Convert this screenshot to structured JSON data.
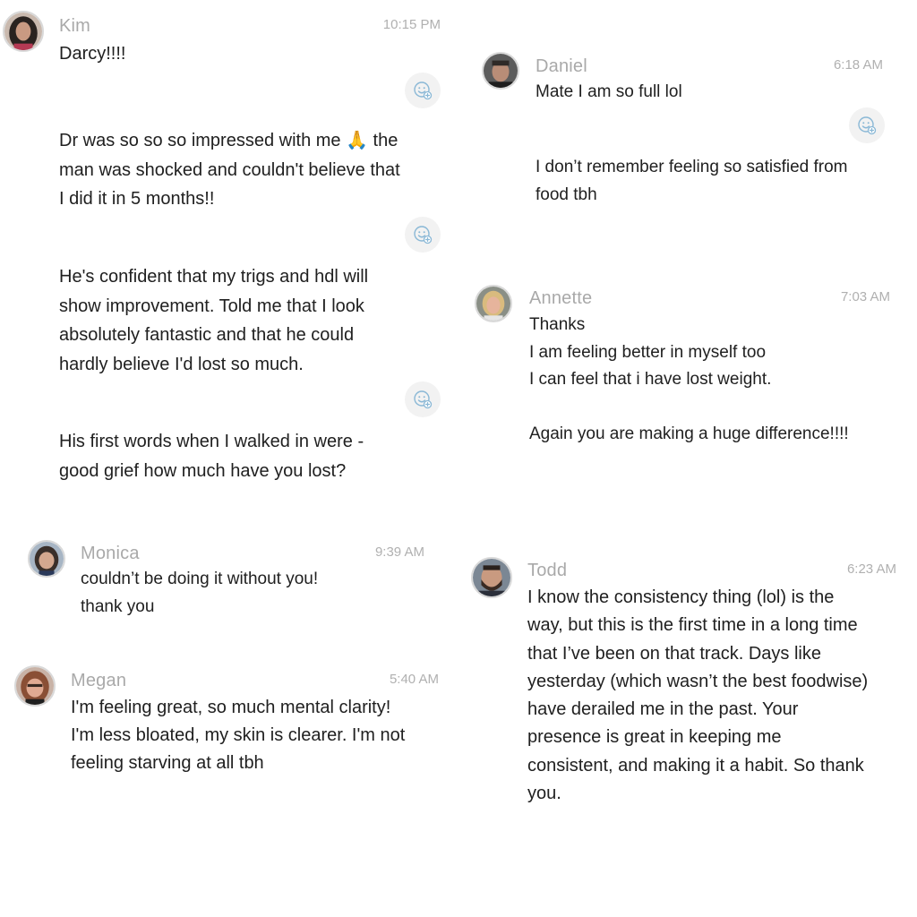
{
  "colors": {
    "name": "#a9a9a9",
    "time": "#b0b0b0",
    "text": "#202020",
    "react_icon": "#8ab8d6",
    "react_bg": "#f2f2f2"
  },
  "messages": {
    "kim": {
      "name": "Kim",
      "time": "10:15 PM",
      "texts": [
        "Darcy!!!!",
        "Dr was so so so impressed with me 🙏 the\nman was shocked and couldn't believe that\nI did it in 5 months!!",
        "He's confident that my trigs and hdl will\nshow improvement. Told me that I look\nabsolutely fantastic and that he could\nhardly believe I'd lost so much.",
        "His first words when I walked in were -\ngood grief how much have you lost?"
      ]
    },
    "daniel": {
      "name": "Daniel",
      "time": "6:18 AM",
      "texts": [
        "Mate I am so full lol",
        "I don’t remember feeling so satisfied from\nfood tbh"
      ]
    },
    "annette": {
      "name": "Annette",
      "time": "7:03 AM",
      "text": "Thanks\nI am feeling better in myself too\nI can feel that i have lost weight.\n\nAgain you are making a huge difference!!!!"
    },
    "monica": {
      "name": "Monica",
      "time": "9:39 AM",
      "text": "couldn’t be doing it without you!\nthank you"
    },
    "megan": {
      "name": "Megan",
      "time": "5:40 AM",
      "text": "I'm feeling great, so much mental clarity!\nI'm less bloated, my skin is clearer. I'm not\nfeeling starving at all tbh"
    },
    "todd": {
      "name": "Todd",
      "time": "6:23 AM",
      "text": "I know the consistency thing (lol) is the\nway, but this is the first time in a long time\nthat I’ve been on that track. Days like\nyesterday (which wasn’t the best foodwise)\nhave derailed me in the past. Your\npresence is great in keeping me\nconsistent, and making it a habit. So thank\nyou."
    }
  }
}
